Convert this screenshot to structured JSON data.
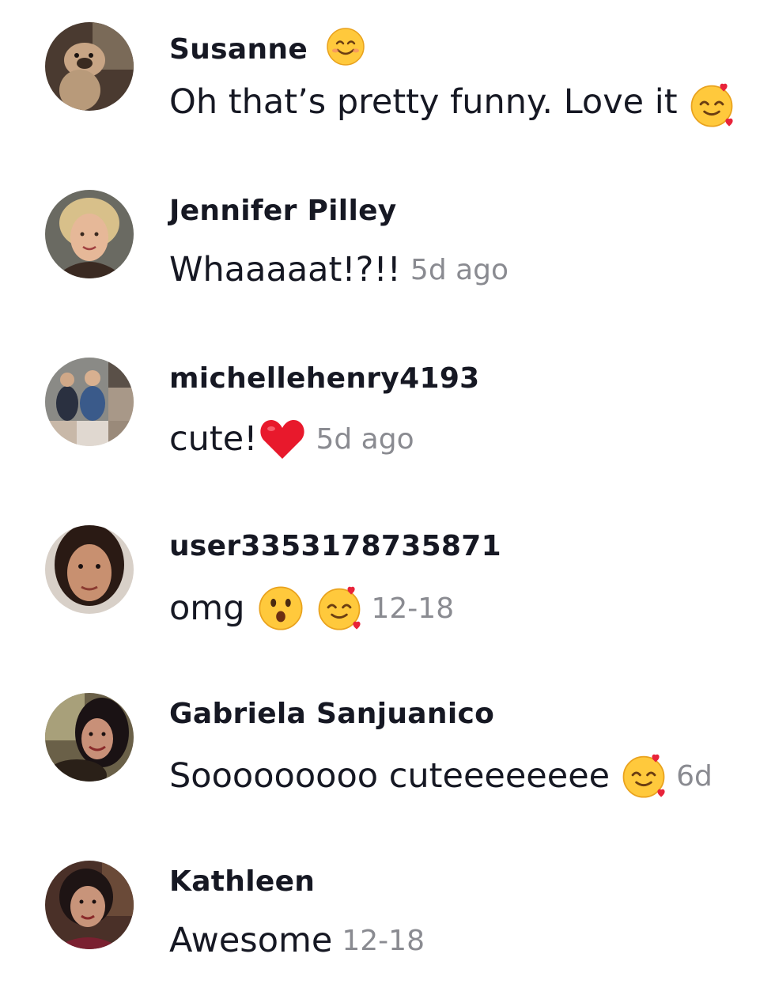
{
  "comments": [
    {
      "username": "Susanne",
      "username_emoji": "smiling-face-emoji",
      "text": "Oh that’s pretty funny. Love it",
      "text_emoji": "smiling-face-with-hearts-emoji",
      "time": ""
    },
    {
      "username": "Jennifer Pilley",
      "text": "Whaaaaat!?!!",
      "time": "5d ago"
    },
    {
      "username": "michellehenry4193",
      "text": "cute!",
      "text_emoji": "red-heart-emoji",
      "time": "5d ago"
    },
    {
      "username": "user3353178735871",
      "text": "omg",
      "text_emojis": [
        "astonished-face-emoji",
        "smiling-face-with-hearts-emoji"
      ],
      "time": "12-18"
    },
    {
      "username": "Gabriela Sanjuanico",
      "text": "Sooooooooo cuteeeeeeee",
      "text_emoji": "smiling-face-with-hearts-emoji",
      "time": "6d"
    },
    {
      "username": "Kathleen",
      "text": "Awesome",
      "time": "12-18"
    }
  ],
  "colors": {
    "username": "#161823",
    "text": "#161823",
    "timestamp": "#8a8b91",
    "background": "#ffffff"
  }
}
